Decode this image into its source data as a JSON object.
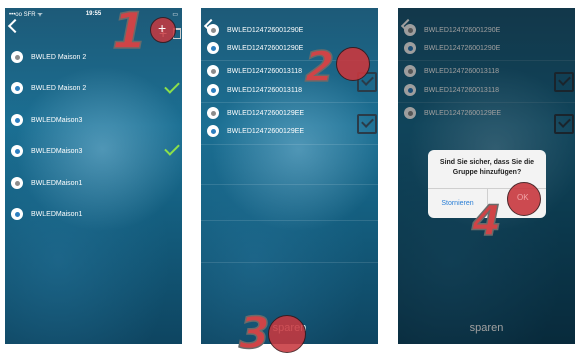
{
  "statusbar": {
    "carrier": "•••oo SFR ᯤ",
    "time": "19:55",
    "battery": "▭"
  },
  "screen1": {
    "items": [
      {
        "label": "BWLED Maison 2",
        "checked": false
      },
      {
        "label": "BWLED Maison 2",
        "checked": true
      },
      {
        "label": "BWLEDMaison3",
        "checked": false
      },
      {
        "label": "BWLEDMaison3",
        "checked": true
      },
      {
        "label": "BWLEDMaison1",
        "checked": false
      },
      {
        "label": "BWLEDMaison1",
        "checked": false
      }
    ],
    "add_glyph": "+"
  },
  "screen2": {
    "items": [
      {
        "label": "BWLED12472600129​0E",
        "checked": false
      },
      {
        "label": "BWLED124726001290E",
        "checked": false
      },
      {
        "label": "BWLED1247260013118",
        "checked": false
      },
      {
        "label": "BWLED1247260013118",
        "checked": true
      },
      {
        "label": "BWLED12472600129EE",
        "checked": false
      },
      {
        "label": "BWLED12472600129EE",
        "checked": true
      }
    ],
    "save_label": "sparen"
  },
  "screen3": {
    "items": [
      {
        "label": "BWLED124726001290E"
      },
      {
        "label": "BWLED124726001290E"
      },
      {
        "label": "BWLED1247260013118"
      },
      {
        "label": "BWLED1247260013118"
      },
      {
        "label": "BWLED12472600129EE"
      }
    ],
    "dialog": {
      "message": "Sind Sie sicher, dass Sie die Gruppe hinzufügen?",
      "cancel_label": "Stornieren",
      "ok_label": "OK"
    },
    "save_label": "sparen"
  },
  "steps": {
    "one": "1",
    "two": "2",
    "three": "3",
    "four": "4"
  },
  "colors": {
    "step_marker": "#c8383f",
    "checkmark": "#8ce04a",
    "dialog_button": "#2b7fd6"
  }
}
